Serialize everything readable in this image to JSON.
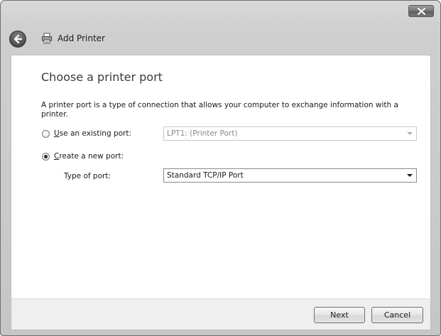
{
  "window": {
    "title": "Add Printer"
  },
  "page": {
    "heading": "Choose a printer port",
    "description": "A printer port is a type of connection that allows your computer to exchange information with a printer."
  },
  "options": {
    "existing_port": {
      "label_prefix": "",
      "label_mnemonic": "U",
      "label_rest": "se an existing port:",
      "selected": false,
      "combo_value": "LPT1: (Printer Port)"
    },
    "new_port": {
      "label_mnemonic": "C",
      "label_rest": "reate a new port:",
      "selected": true,
      "type_label": "Type of port:",
      "combo_value": "Standard TCP/IP Port"
    }
  },
  "footer": {
    "next_label": "Next",
    "cancel_label": "Cancel"
  },
  "icons": {
    "back": "back-arrow-icon",
    "printer": "printer-icon",
    "close": "close-icon"
  }
}
